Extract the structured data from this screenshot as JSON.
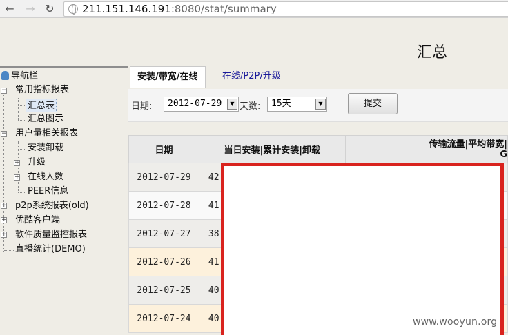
{
  "browser": {
    "url_host": "211.151.146.191",
    "url_rest": ":8080/stat/summary",
    "icons": [
      "back-arrow-icon",
      "forward-arrow-icon",
      "reload-icon",
      "globe-icon"
    ]
  },
  "page": {
    "title": "汇总"
  },
  "sidebar": {
    "root": "导航栏",
    "groups": [
      {
        "label": "常用指标报表",
        "items": [
          "汇总表",
          "汇总图示"
        ]
      },
      {
        "label": "用户量相关报表",
        "items": [
          "安装卸载",
          "升级",
          "在线人数",
          "PEER信息"
        ]
      },
      {
        "label": "p2p系统报表(old)",
        "items": []
      },
      {
        "label": "优酷客户端",
        "items": []
      },
      {
        "label": "软件质量监控报表",
        "items": []
      }
    ],
    "last_item": "直播统计(DEMO)",
    "selected": "汇总表"
  },
  "tabs": {
    "active": "安装/带宽/在线",
    "other": "在线/P2P/升级"
  },
  "filter": {
    "date_label": "日期:",
    "date_value": "2012-07-29",
    "days_label": "天数:",
    "days_value": "15天",
    "submit_label": "提交"
  },
  "table": {
    "headers": [
      "日期",
      "当日安装|累计安装|卸载",
      "传输流量|平均带宽|",
      "G"
    ],
    "rows": [
      {
        "date": "2012-07-29",
        "partial": "42"
      },
      {
        "date": "2012-07-28",
        "partial": "41"
      },
      {
        "date": "2012-07-27",
        "partial": "38"
      },
      {
        "date": "2012-07-26",
        "partial": "41"
      },
      {
        "date": "2012-07-25",
        "partial": "40"
      },
      {
        "date": "2012-07-24",
        "partial": "40"
      }
    ]
  },
  "watermark": "www.wooyun.org",
  "colors": {
    "redact_border": "#d9231e",
    "row_highlight": "#fdf1dc",
    "link": "#1a1a9a"
  }
}
